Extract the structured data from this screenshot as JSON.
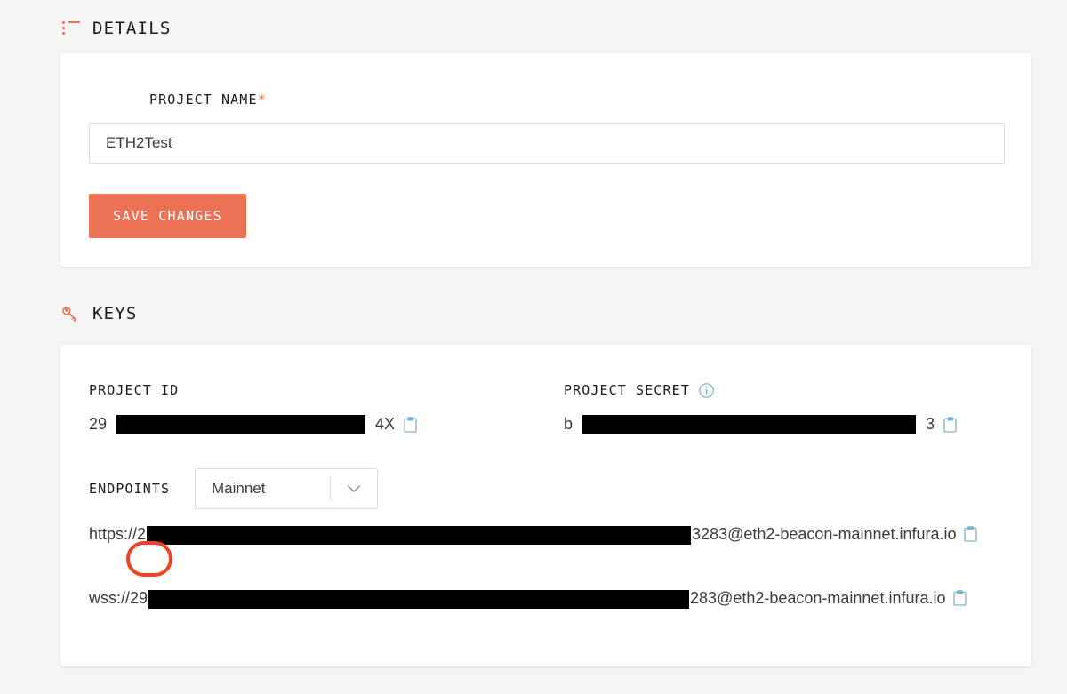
{
  "theme": {
    "page_bg": "#f5f5f5",
    "card_bg": "#ffffff",
    "accent": "#ed6f4c",
    "button_bg": "#ed7255",
    "icon_blue": "#7fb4cc",
    "annotation": "#ef4123",
    "redaction": "#000000"
  },
  "details_section": {
    "header": "DETAILS",
    "header_icon": "list-icon",
    "project_name_label": "PROJECT NAME",
    "required_marker": "*",
    "project_name_value": "ETH2Test",
    "project_name_placeholder": "Project name",
    "save_label": "SAVE CHANGES"
  },
  "keys_section": {
    "header": "KEYS",
    "header_icon": "key-icon",
    "project_id_label": "PROJECT ID",
    "project_id_prefix": "29",
    "project_id_suffix": "4X",
    "project_secret_label": "PROJECT SECRET",
    "project_secret_info_icon": "info-icon",
    "project_secret_prefix": "b",
    "project_secret_suffix": "3",
    "copy_icon": "clipboard-icon",
    "endpoints_label": "ENDPOINTS",
    "network_selected": "Mainnet",
    "network_options": [
      "Mainnet"
    ],
    "dropdown_icon": "chevron-down-icon",
    "endpoints": [
      {
        "scheme_prefix": "https://2",
        "suffix": "3283@eth2-beacon-mainnet.infura.io",
        "copy_icon": "clipboard-icon",
        "highlighted": true
      },
      {
        "scheme_prefix": "wss://29",
        "suffix": "283@eth2-beacon-mainnet.infura.io",
        "copy_icon": "clipboard-icon",
        "highlighted": false
      }
    ]
  },
  "annotation": {
    "shape": "rounded-rectangle-highlight",
    "color": "#ef4123",
    "targets": "copy-icon of https endpoint"
  }
}
